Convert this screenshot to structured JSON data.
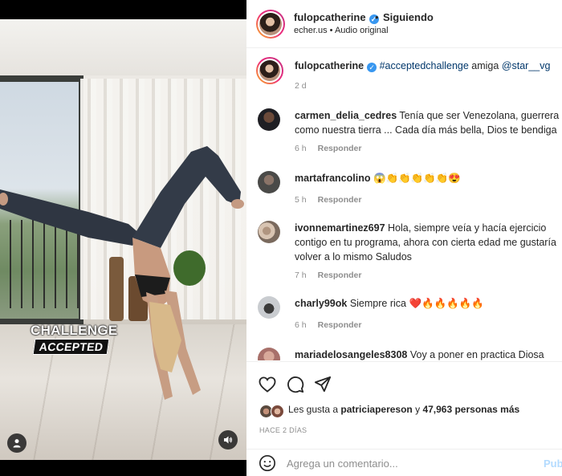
{
  "media": {
    "sticker_line1": "CHALLENGE",
    "sticker_line2": "ACCEPTED",
    "user_tag_icon": "person-icon",
    "sound_icon": "speaker-icon"
  },
  "header": {
    "username": "fulopcatherine",
    "separator": "•",
    "follow_status": "Siguiendo",
    "subline": "echer.us • Audio original"
  },
  "caption": {
    "username": "fulopcatherine",
    "hashtag": "#acceptedchallenge",
    "text_mid": " amiga ",
    "mention": "@star__vg",
    "time": "2 d"
  },
  "comments": [
    {
      "username": "carmen_delia_cedres",
      "text": "Tenía que ser Venezolana, guerrera como nuestra tierra ... Cada día más bella, Dios te bendiga",
      "time": "6 h",
      "reply": "Responder"
    },
    {
      "username": "martafrancolino",
      "text": "😱👏👏👏👏👏😍",
      "time": "5 h",
      "reply": "Responder"
    },
    {
      "username": "ivonnemartinez697",
      "text": "Hola, siempre veía y hacía ejercicio contigo en tu programa, ahora con cierta edad me gustaría volver a lo mismo Saludos",
      "time": "7 h",
      "reply": "Responder"
    },
    {
      "username": "charly99ok",
      "text": "Siempre rica ❤️🔥🔥🔥🔥🔥",
      "time": "6 h",
      "reply": "Responder"
    },
    {
      "username": "mariadelosangeles8308",
      "text": "Voy a poner en practica Diosa",
      "time": "",
      "reply": ""
    }
  ],
  "actions": {
    "like_icon": "heart-icon",
    "comment_icon": "comment-icon",
    "share_icon": "send-icon",
    "likes_prefix": "Les gusta a ",
    "likes_user": "patriciapereson",
    "likes_mid": " y ",
    "likes_count": "47,963 personas más",
    "posted_ago": "HACE 2 DÍAS"
  },
  "add_comment": {
    "emoji_icon": "smiley-icon",
    "placeholder": "Agrega un comentario...",
    "post_label": "Publicar"
  },
  "colors": {
    "verified": "#3897f0",
    "link": "#00376b",
    "muted": "#8e8e8e",
    "post_disabled": "#b3dbff"
  }
}
